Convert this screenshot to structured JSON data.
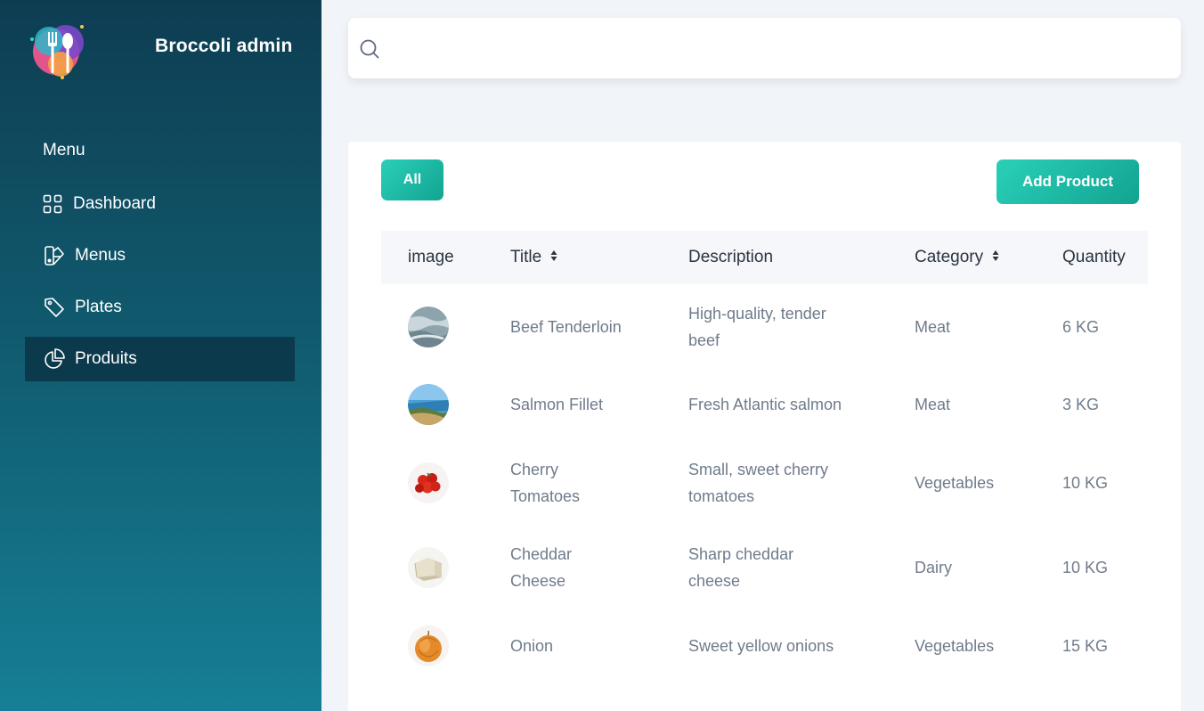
{
  "brand": {
    "name": "Broccoli admin"
  },
  "sidebar": {
    "heading": "Menu",
    "items": [
      {
        "label": "Dashboard",
        "icon": "grid-icon",
        "active": false
      },
      {
        "label": "Menus",
        "icon": "book-icon",
        "active": false
      },
      {
        "label": "Plates",
        "icon": "tag-icon",
        "active": false
      },
      {
        "label": "Produits",
        "icon": "pie-chart-icon",
        "active": true
      }
    ]
  },
  "search": {
    "value": "",
    "placeholder": ""
  },
  "toolbar": {
    "filter_all_label": "All",
    "add_product_label": "Add Product"
  },
  "table": {
    "columns": [
      "image",
      "Title",
      "Description",
      "Category",
      "Quantity"
    ],
    "rows": [
      {
        "image": "beef-thumbnail",
        "title": "Beef Tenderloin",
        "description": "High-quality, tender beef",
        "category": "Meat",
        "quantity": "6 KG"
      },
      {
        "image": "salmon-thumbnail",
        "title": "Salmon Fillet",
        "description": "Fresh Atlantic salmon",
        "category": "Meat",
        "quantity": "3 KG"
      },
      {
        "image": "tomatoes-thumbnail",
        "title": "Cherry Tomatoes",
        "description": "Small, sweet cherry tomatoes",
        "category": "Vegetables",
        "quantity": "10 KG"
      },
      {
        "image": "cheese-thumbnail",
        "title": "Cheddar Cheese",
        "description": "Sharp cheddar cheese",
        "category": "Dairy",
        "quantity": "10 KG"
      },
      {
        "image": "onion-thumbnail",
        "title": "Onion",
        "description": "Sweet yellow onions",
        "category": "Vegetables",
        "quantity": "15 KG"
      }
    ]
  },
  "colors": {
    "sidebar_top": "#0e3d52",
    "sidebar_bottom": "#167f96",
    "active_item": "#0c3a4d",
    "accent": "#1ab8a3",
    "page_bg": "#f1f4f8"
  }
}
